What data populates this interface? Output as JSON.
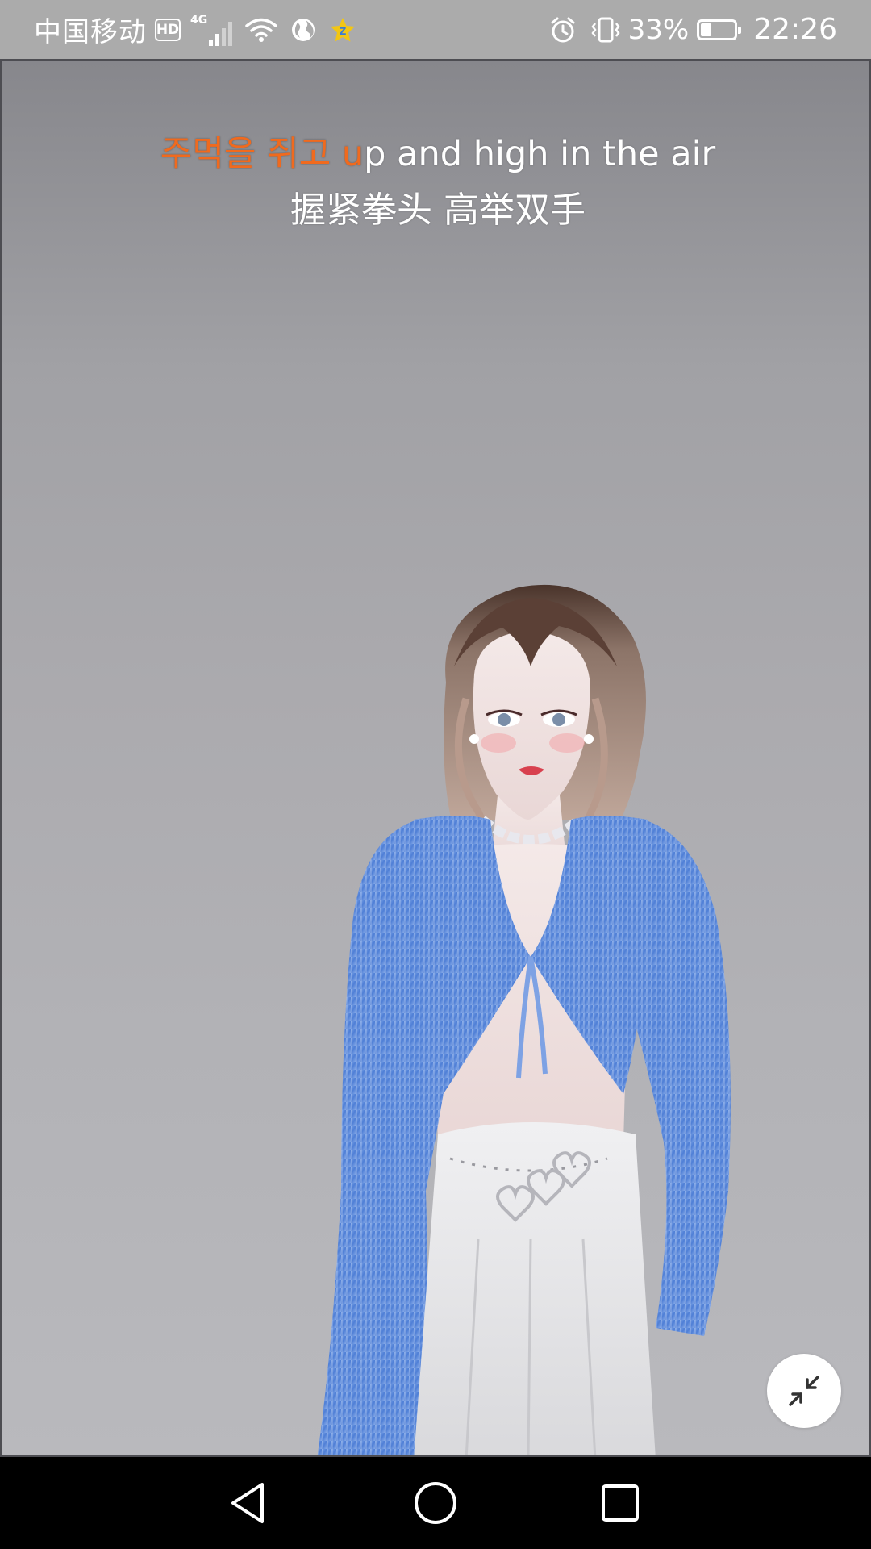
{
  "status_bar": {
    "carrier": "中国移动",
    "hd_badge": "HD",
    "network_type": "4G",
    "battery_percent": "33%",
    "battery_level": 0.33,
    "time": "22:26",
    "icons": [
      "hd-icon",
      "signal-icon",
      "wifi-icon",
      "globe-icon",
      "star-badge-icon",
      "alarm-icon",
      "vibrate-icon",
      "battery-icon"
    ]
  },
  "lyrics": {
    "line1_sung": "주먹을 쥐고 u",
    "line1_rest": "p and high in the air",
    "line2": "握紧拳头 高举双手"
  },
  "controls": {
    "shrink_icon": "minimize-arrows-icon"
  },
  "nav_bar": {
    "icons": [
      "back-triangle-icon",
      "home-circle-icon",
      "recents-square-icon"
    ]
  },
  "colors": {
    "lyric_highlight": "#f06a1e",
    "lyric_text": "#ffffff",
    "status_bar_bg": "#ababab",
    "nav_bar_bg": "#000000",
    "blouse": "#5a86d8",
    "skirt": "#e8e8ea"
  }
}
